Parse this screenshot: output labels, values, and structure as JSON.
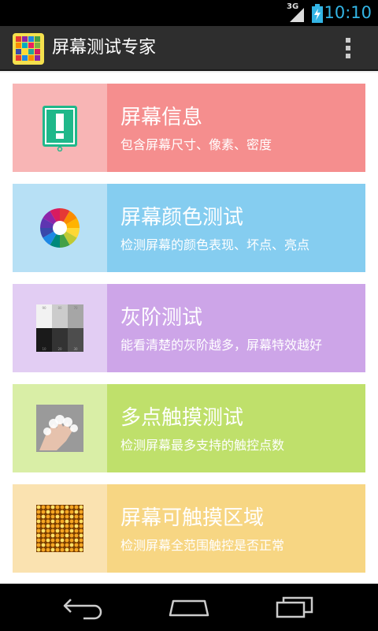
{
  "status_bar": {
    "network": "3G",
    "time": "10:10"
  },
  "app": {
    "title": "屏幕测试专家",
    "icon": "color-grid-app-icon"
  },
  "cards": [
    {
      "title": "屏幕信息",
      "subtitle": "包含屏幕尺寸、像素、密度",
      "icon": "exclamation-sign-icon",
      "left_color": "#f8b5b5",
      "right_color": "#f58e8e"
    },
    {
      "title": "屏幕颜色测试",
      "subtitle": "检测屏幕的颜色表现、坏点、亮点",
      "icon": "color-wheel-icon",
      "left_color": "#b7e0f5",
      "right_color": "#85cdf0"
    },
    {
      "title": "灰阶测试",
      "subtitle": "能看清楚的灰阶越多，屏幕特效越好",
      "icon": "grayscale-icon",
      "left_color": "#e2cdf3",
      "right_color": "#cda5e8",
      "gray_labels": [
        "90",
        "80",
        "70",
        "10",
        "20",
        "30"
      ]
    },
    {
      "title": "多点触摸测试",
      "subtitle": "检测屏幕最多支持的触控点数",
      "icon": "multitouch-hand-icon",
      "left_color": "#d9eea6",
      "right_color": "#bfe06b"
    },
    {
      "title": "屏幕可触摸区域",
      "subtitle": "检测屏幕全范围触控是否正常",
      "icon": "led-grid-icon",
      "left_color": "#fae2b0",
      "right_color": "#f7d683"
    }
  ]
}
